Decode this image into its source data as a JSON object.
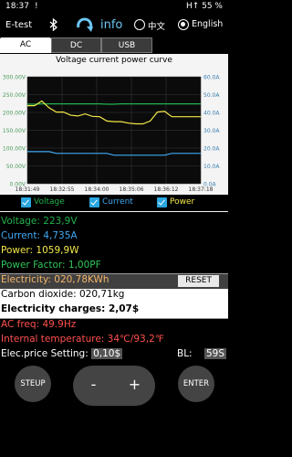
{
  "status_bar": {
    "time": "18:37",
    "alert": "!",
    "right": "H↑ 55 %"
  },
  "app": {
    "title": "E-test",
    "info_label": "info"
  },
  "language": {
    "chinese_label": "中文",
    "english_label": "English",
    "selected": "English"
  },
  "tabs": [
    {
      "label": "AC",
      "active": true
    },
    {
      "label": "DC",
      "active": false
    },
    {
      "label": "USB",
      "active": false
    }
  ],
  "chart_data": {
    "type": "line",
    "title": "Voltage current power curve",
    "x_ticks": [
      "18:31:49",
      "18:32:55",
      "18:34:00",
      "18:35:06",
      "18:36:12",
      "18:37:18"
    ],
    "y_left_ticks": [
      "300.00V",
      "250.00V",
      "200.00V",
      "150.00V",
      "100.00V",
      "50.00V",
      "0.00V"
    ],
    "y_right_ticks": [
      "60.0A",
      "50.0A",
      "40.0A",
      "30.0A",
      "20.0A",
      "10.0A",
      "0.0A"
    ],
    "ylim_left": [
      0,
      300
    ],
    "ylim_right": [
      0,
      60
    ],
    "grid": true,
    "series": [
      {
        "name": "Voltage",
        "color": "#22b14c",
        "values": [
          223,
          223,
          224,
          224,
          224,
          224,
          224,
          224,
          224,
          224,
          224,
          223,
          223,
          224,
          224,
          224,
          224,
          224,
          224,
          224,
          224,
          224,
          224,
          224,
          224
        ]
      },
      {
        "name": "Current",
        "color": "#3fa9f5",
        "values": [
          18,
          18,
          18,
          18,
          17,
          17,
          17,
          17,
          17,
          17,
          17,
          17,
          16,
          16,
          16,
          16,
          16,
          16,
          16,
          16,
          17,
          17,
          17,
          17,
          17
        ]
      },
      {
        "name": "Power",
        "color": "#f2e84a",
        "values": [
          219,
          219,
          232,
          213,
          201,
          201,
          192,
          190,
          196,
          189,
          188,
          176,
          174,
          174,
          170,
          168,
          168,
          176,
          201,
          203,
          188,
          188,
          188,
          188,
          188
        ]
      }
    ]
  },
  "legend": [
    {
      "label": "Voltage",
      "color": "#22b14c"
    },
    {
      "label": "Current",
      "color": "#3fa9f5"
    },
    {
      "label": "Power",
      "color": "#f2e84a"
    }
  ],
  "readings": {
    "voltage": "Voltage: 223,9V",
    "current": "Current: 4,735A",
    "power": "Power: 1059,9W",
    "power_factor": "Power Factor: 1,00PF",
    "electricity": "Electricity: 020,78KWh",
    "reset_label": "RESET",
    "carbon": "Carbon dioxide: 020,71kg",
    "charges": "Electricity charges: 2,07$",
    "ac_freq": "AC freq: 49.9Hz",
    "temperature": "Internal temperature: 34℃/93,2℉",
    "price_label": "Elec.price Setting:",
    "price_value": "0,10$",
    "bl_label": "BL:",
    "bl_value": "59S"
  },
  "colors": {
    "voltage": "#22b14c",
    "current": "#3fa9f5",
    "power": "#f2e84a",
    "power_factor": "#2fc65a",
    "electricity": "#f4b66b",
    "charges": "#f2e84a",
    "ac_freq": "#ff4f4f",
    "temperature": "#ff4f4f"
  },
  "controls": {
    "setup_label": "STEUP",
    "minus_label": "-",
    "plus_label": "+",
    "enter_label": "ENTER"
  }
}
